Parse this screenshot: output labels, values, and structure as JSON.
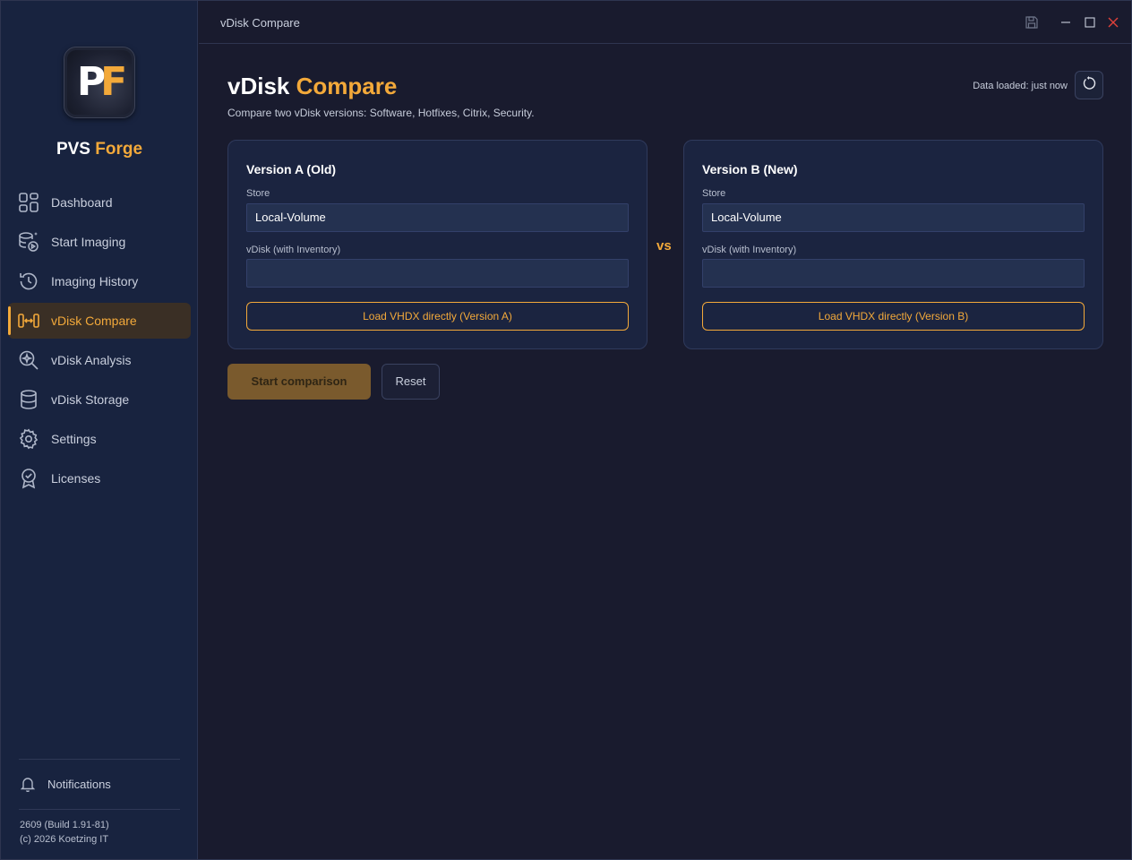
{
  "window": {
    "title": "vDisk Compare"
  },
  "brand": {
    "logo_text_p": "P",
    "logo_text_f": "F",
    "name_part1": "PVS",
    "name_part2": "Forge"
  },
  "sidebar": {
    "items": [
      {
        "label": "Dashboard",
        "icon": "dashboard-grid-icon"
      },
      {
        "label": "Start Imaging",
        "icon": "start-imaging-icon"
      },
      {
        "label": "Imaging History",
        "icon": "history-icon"
      },
      {
        "label": "vDisk Compare",
        "icon": "compare-icon",
        "active": true
      },
      {
        "label": "vDisk Analysis",
        "icon": "analysis-icon"
      },
      {
        "label": "vDisk Storage",
        "icon": "database-icon"
      },
      {
        "label": "Settings",
        "icon": "gear-icon"
      },
      {
        "label": "Licenses",
        "icon": "license-badge-icon"
      }
    ],
    "notifications_label": "Notifications",
    "version_line1": "2609 (Build 1.91-81)",
    "version_line2": "(c) 2026 Koetzing IT"
  },
  "header": {
    "title_part1": "vDisk",
    "title_part2": "Compare",
    "subtitle": "Compare two vDisk versions: Software, Hotfixes, Citrix, Security.",
    "data_loaded": "Data loaded: just now"
  },
  "version_a": {
    "title": "Version A (Old)",
    "store_label": "Store",
    "store_value": "Local-Volume",
    "vdisk_label": "vDisk (with Inventory)",
    "vdisk_value": "",
    "load_button": "Load VHDX directly (Version A)"
  },
  "version_b": {
    "title": "Version B (New)",
    "store_label": "Store",
    "store_value": "Local-Volume",
    "vdisk_label": "vDisk (with Inventory)",
    "vdisk_value": "",
    "load_button": "Load VHDX directly (Version B)"
  },
  "vs_label": "vs",
  "actions": {
    "start": "Start comparison",
    "reset": "Reset"
  },
  "colors": {
    "accent": "#f3a93a",
    "sidebar_bg": "#18233f",
    "main_bg": "#191b2e",
    "card_bg": "#1b2440",
    "close": "#e0413a"
  }
}
